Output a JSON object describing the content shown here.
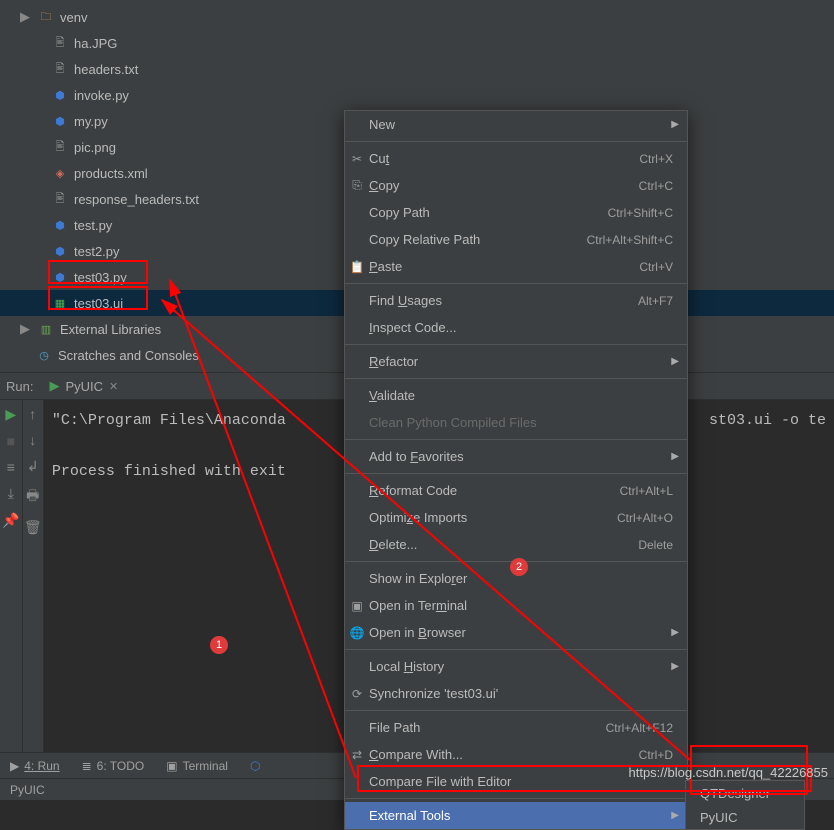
{
  "tree": {
    "folder": "venv",
    "files": [
      {
        "name": "ha.JPG",
        "icon": "file"
      },
      {
        "name": "headers.txt",
        "icon": "file"
      },
      {
        "name": "invoke.py",
        "icon": "py"
      },
      {
        "name": "my.py",
        "icon": "py"
      },
      {
        "name": "pic.png",
        "icon": "file"
      },
      {
        "name": "products.xml",
        "icon": "xml"
      },
      {
        "name": "response_headers.txt",
        "icon": "file"
      },
      {
        "name": "test.py",
        "icon": "py"
      },
      {
        "name": "test2.py",
        "icon": "py"
      },
      {
        "name": "test03.py",
        "icon": "py"
      },
      {
        "name": "test03.ui",
        "icon": "ui",
        "selected": true
      }
    ],
    "external_libs": "External Libraries",
    "scratches": "Scratches and Consoles"
  },
  "context_menu": {
    "items": [
      {
        "label": "New",
        "submenu": true
      },
      {
        "sep": true
      },
      {
        "icon": "✂",
        "label": "Cut",
        "u": "t",
        "shortcut": "Ctrl+X"
      },
      {
        "icon": "⎘",
        "label": "Copy",
        "u": "C",
        "shortcut": "Ctrl+C"
      },
      {
        "label": "Copy Path",
        "shortcut": "Ctrl+Shift+C"
      },
      {
        "label": "Copy Relative Path",
        "shortcut": "Ctrl+Alt+Shift+C"
      },
      {
        "icon": "📋",
        "label": "Paste",
        "u": "P",
        "shortcut": "Ctrl+V"
      },
      {
        "sep": true
      },
      {
        "label": "Find Usages",
        "u": "U",
        "shortcut": "Alt+F7"
      },
      {
        "label": "Inspect Code...",
        "u": "I"
      },
      {
        "sep": true
      },
      {
        "label": "Refactor",
        "u": "R",
        "submenu": true
      },
      {
        "sep": true
      },
      {
        "label": "Validate",
        "u": "V"
      },
      {
        "label": "Clean Python Compiled Files",
        "disabled": true
      },
      {
        "sep": true
      },
      {
        "label": "Add to Favorites",
        "u": "F",
        "submenu": true
      },
      {
        "sep": true
      },
      {
        "label": "Reformat Code",
        "u": "R",
        "shortcut": "Ctrl+Alt+L"
      },
      {
        "label": "Optimize Imports",
        "u": "z",
        "shortcut": "Ctrl+Alt+O"
      },
      {
        "label": "Delete...",
        "u": "D",
        "shortcut": "Delete"
      },
      {
        "sep": true
      },
      {
        "label": "Show in Explorer",
        "u": "r"
      },
      {
        "icon": "▣",
        "label": "Open in Terminal",
        "u": "m"
      },
      {
        "icon": "🌐",
        "label": "Open in Browser",
        "u": "B",
        "submenu": true
      },
      {
        "sep": true
      },
      {
        "label": "Local History",
        "u": "H",
        "submenu": true
      },
      {
        "icon": "⟳",
        "label": "Synchronize 'test03.ui'"
      },
      {
        "sep": true
      },
      {
        "label": "File Path",
        "shortcut": "Ctrl+Alt+F12"
      },
      {
        "icon": "⇄",
        "label": "Compare With...",
        "u": "C",
        "shortcut": "Ctrl+D"
      },
      {
        "label": "Compare File with Editor"
      },
      {
        "sep": true
      },
      {
        "label": "External Tools",
        "selected": true,
        "submenu": true
      }
    ],
    "submenu_ext": [
      "QTDesigner",
      "PyUIC"
    ]
  },
  "run": {
    "label": "Run:",
    "tab": "PyUIC",
    "line1": "\"C:\\Program Files\\Anaconda",
    "line1_tail": "st03.ui -o te",
    "line2": "Process finished with exit"
  },
  "tool_strip": {
    "run": "4: Run",
    "todo": "6: TODO",
    "terminal": "Terminal"
  },
  "status": "PyUIC",
  "annotations": {
    "c1": "1",
    "c2": "2"
  },
  "watermark": "https://blog.csdn.net/qq_42226855"
}
